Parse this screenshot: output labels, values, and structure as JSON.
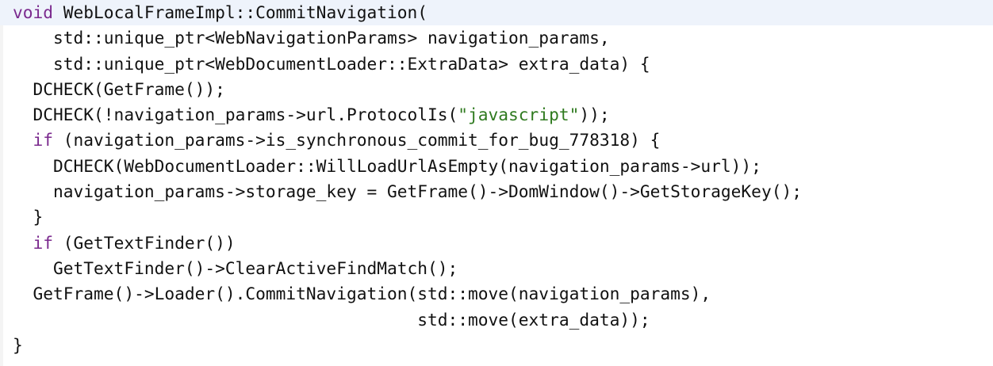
{
  "editor": {
    "language": "cpp",
    "colors": {
      "keyword": "#7b2a8e",
      "string": "#2f7a1f",
      "text": "#111111",
      "current_line_highlight": "#eef3fb"
    },
    "lines": [
      [
        {
          "t": "kw",
          "v": "void"
        },
        {
          "t": "plain",
          "v": " WebLocalFrameImpl::CommitNavigation("
        }
      ],
      [
        {
          "t": "plain",
          "v": "    std::unique_ptr<WebNavigationParams> navigation_params,"
        }
      ],
      [
        {
          "t": "plain",
          "v": "    std::unique_ptr<WebDocumentLoader::ExtraData> extra_data) {"
        }
      ],
      [
        {
          "t": "plain",
          "v": "  DCHECK(GetFrame());"
        }
      ],
      [
        {
          "t": "plain",
          "v": "  DCHECK(!navigation_params->url.ProtocolIs("
        },
        {
          "t": "str",
          "v": "\"javascript\""
        },
        {
          "t": "plain",
          "v": "));"
        }
      ],
      [
        {
          "t": "plain",
          "v": "  "
        },
        {
          "t": "kw",
          "v": "if"
        },
        {
          "t": "plain",
          "v": " (navigation_params->is_synchronous_commit_for_bug_778318) {"
        }
      ],
      [
        {
          "t": "plain",
          "v": "    DCHECK(WebDocumentLoader::WillLoadUrlAsEmpty(navigation_params->url));"
        }
      ],
      [
        {
          "t": "plain",
          "v": "    navigation_params->storage_key = GetFrame()->DomWindow()->GetStorageKey();"
        }
      ],
      [
        {
          "t": "plain",
          "v": "  }"
        }
      ],
      [
        {
          "t": "plain",
          "v": "  "
        },
        {
          "t": "kw",
          "v": "if"
        },
        {
          "t": "plain",
          "v": " (GetTextFinder())"
        }
      ],
      [
        {
          "t": "plain",
          "v": "    GetTextFinder()->ClearActiveFindMatch();"
        }
      ],
      [
        {
          "t": "plain",
          "v": "  GetFrame()->Loader().CommitNavigation(std::move(navigation_params),"
        }
      ],
      [
        {
          "t": "plain",
          "v": "                                        std::move(extra_data));"
        }
      ],
      [
        {
          "t": "plain",
          "v": "}"
        }
      ]
    ]
  }
}
